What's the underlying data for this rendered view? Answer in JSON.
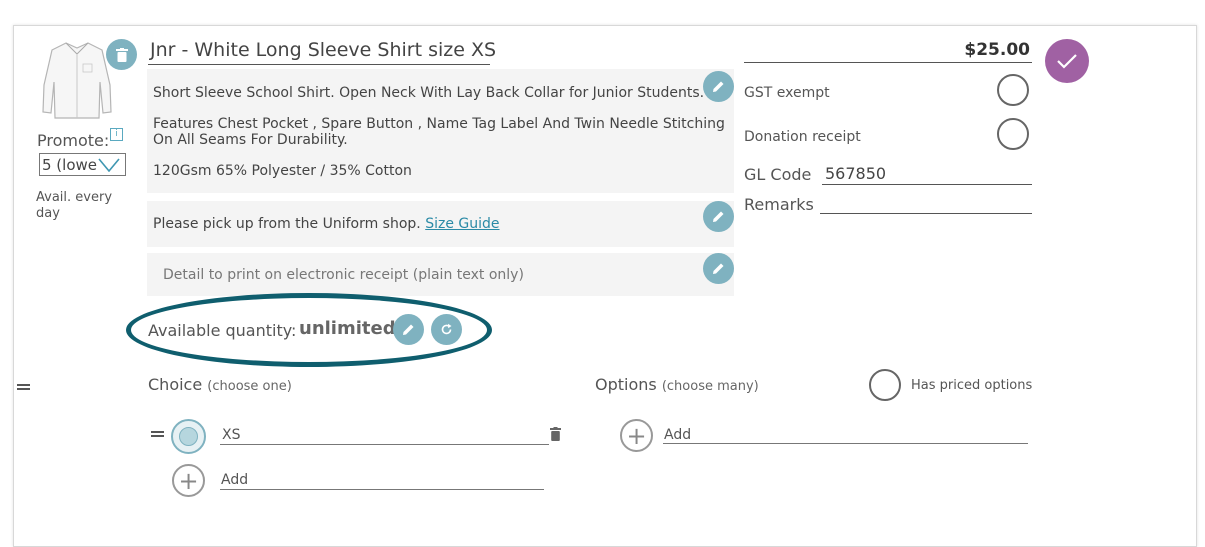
{
  "product": {
    "title": "Jnr - White Long Sleeve Shirt size XS",
    "price": "$25.00",
    "image_alt": "white long sleeve shirt"
  },
  "promote": {
    "label": "Promote:",
    "value": "5 (lowe",
    "availability": "Avail. every day"
  },
  "description": {
    "line1": "Short Sleeve School Shirt. Open Neck With Lay Back Collar for Junior Students.",
    "line2": "Features Chest Pocket , Spare Button , Name Tag Label And Twin Needle Stitching On All Seams For Durability.",
    "line3": "120Gsm 65% Polyester / 35% Cotton"
  },
  "pickup": {
    "text": "Please pick up from the Uniform shop.",
    "link": "Size Guide"
  },
  "receipt_detail": {
    "placeholder": "Detail to print on electronic receipt (plain text only)"
  },
  "quantity": {
    "label": "Available quantity:",
    "value": "unlimited"
  },
  "side": {
    "gst": "GST exempt",
    "donation": "Donation receipt",
    "gl_label": "GL Code",
    "gl_value": "567850",
    "remarks_label": "Remarks",
    "remarks_value": ""
  },
  "choice": {
    "title": "Choice",
    "hint": "(choose one)",
    "items": [
      "XS"
    ],
    "add_label": "Add"
  },
  "options": {
    "title": "Options",
    "hint": "(choose many)",
    "priced_label": "Has priced options",
    "add_label": "Add"
  },
  "colors": {
    "accent": "#7fb2c0",
    "confirm": "#a061a3",
    "highlight_ring": "#0f5e6e"
  }
}
